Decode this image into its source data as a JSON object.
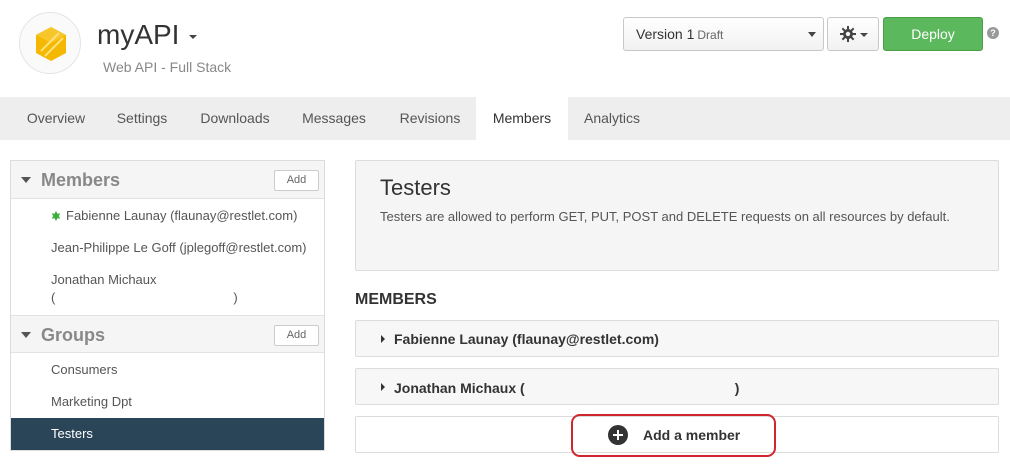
{
  "header": {
    "app_name": "myAPI",
    "subtitle": "Web API - Full Stack",
    "version_label": "Version 1",
    "version_status": "Draft",
    "deploy_label": "Deploy",
    "help_label": "?"
  },
  "tabs": [
    "Overview",
    "Settings",
    "Downloads",
    "Messages",
    "Revisions",
    "Members",
    "Analytics"
  ],
  "active_tab": "Members",
  "sidebar": {
    "members_title": "Members",
    "members_add": "Add",
    "members": [
      "Fabienne Launay (flaunay@restlet.com)",
      "Jean-Philippe Le Goff (jplegoff@restlet.com)",
      "Jonathan Michaux"
    ],
    "redacted_open": "(",
    "redacted_close": ")",
    "groups_title": "Groups",
    "groups_add": "Add",
    "groups": [
      "Consumers",
      "Marketing Dpt",
      "Testers"
    ],
    "selected_group": "Testers"
  },
  "group": {
    "title": "Testers",
    "description": "Testers are allowed to perform GET, PUT, POST and DELETE requests on all resources by default."
  },
  "members_section": {
    "heading": "MEMBERS",
    "rows": [
      "Fabienne Launay (flaunay@restlet.com)",
      "Jonathan Michaux ("
    ],
    "row_close": ")",
    "add_member_label": "Add a member"
  },
  "colors": {
    "deploy": "#5cb85c",
    "selected": "#2b4558",
    "highlight": "#d0262d",
    "online": "#3cb03c"
  }
}
